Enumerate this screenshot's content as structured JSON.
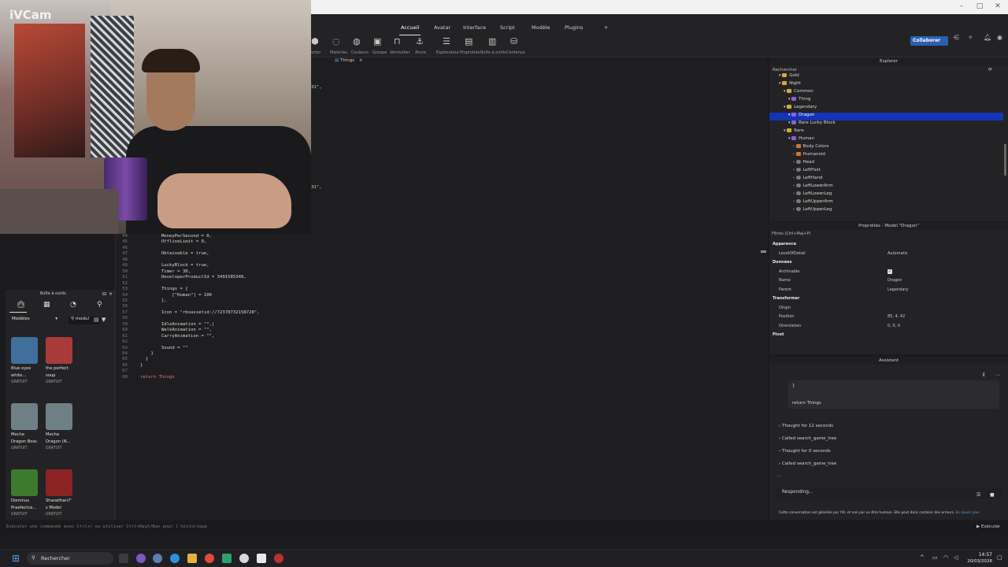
{
  "window": {
    "minimize": "–",
    "maximize": "□",
    "close": "✕"
  },
  "ribbon": {
    "tabs": [
      "Accueil",
      "Avatar",
      "Interface",
      "Script",
      "Modèle",
      "Plugins",
      "+"
    ],
    "collaborate": "Collaborer",
    "tools": [
      "porter",
      "Matériau",
      "Couleurs",
      "Groupe",
      "Verrouiller",
      "Ancre",
      "Explorateur",
      "Propriétés",
      "Boîte à outils",
      "Contenus"
    ]
  },
  "editor": {
    "doc_tab": "Things",
    "top_fragments": [
      "31\",",
      "31\","
    ],
    "lines": [
      {
        "n": "44",
        "text": "        MoneyPerSecond = 0,"
      },
      {
        "n": "45",
        "text": "        OfflineLimit = 0,"
      },
      {
        "n": "46",
        "text": ""
      },
      {
        "n": "47",
        "text": "        Obtainable = true,"
      },
      {
        "n": "48",
        "text": ""
      },
      {
        "n": "49",
        "text": "        LuckyBlock = true,"
      },
      {
        "n": "50",
        "text": "        Timer = 30,"
      },
      {
        "n": "51",
        "text": "        DeveloperProductId = 3491585348,"
      },
      {
        "n": "52",
        "text": ""
      },
      {
        "n": "53",
        "text": "        Things = {"
      },
      {
        "n": "54",
        "text": "            [\"Human\"] = 100"
      },
      {
        "n": "55",
        "text": "        },"
      },
      {
        "n": "56",
        "text": ""
      },
      {
        "n": "57",
        "text": "        Icon = \"rbxassetid://72378732158728\","
      },
      {
        "n": "58",
        "text": ""
      },
      {
        "n": "59",
        "text": "        IdleAnimation = \"\",|"
      },
      {
        "n": "60",
        "text": "        WalkAnimation = \"\","
      },
      {
        "n": "61",
        "text": "        CarryAnimation = \"\","
      },
      {
        "n": "62",
        "text": ""
      },
      {
        "n": "63",
        "text": "        Sound = \"\""
      },
      {
        "n": "64",
        "text": "    }"
      },
      {
        "n": "65",
        "text": "  }"
      },
      {
        "n": "66",
        "text": "}"
      },
      {
        "n": "67",
        "text": ""
      },
      {
        "n": "68",
        "text": "return Things"
      }
    ]
  },
  "toolbox": {
    "title": "Boîte à outils",
    "category": "Modèles",
    "search_value": "modul",
    "assets": [
      {
        "name1": "Blue eyes",
        "name2": "white...",
        "price": "GRATUIT",
        "color": "#3f6f9a"
      },
      {
        "name1": "the perfect",
        "name2": "soup",
        "price": "GRATUIT",
        "color": "#a83a3a"
      },
      {
        "name1": "Mecha",
        "name2": "Dragon Boss",
        "price": "GRATUIT",
        "color": "#6f7f86"
      },
      {
        "name1": "Mecha",
        "name2": "Dragon (N...",
        "price": "GRATUIT",
        "color": "#6f7f86"
      },
      {
        "name1": "Dominus",
        "name2": "Praefectus...",
        "price": "GRATUIT",
        "color": "#3c7a2e"
      },
      {
        "name1": "Shanethan7'",
        "name2": "s Model",
        "price": "GRATUIT",
        "color": "#8b2323"
      }
    ]
  },
  "explorer": {
    "title": "Explorer",
    "search": "Rechercher",
    "items": [
      {
        "label": "Gold",
        "type": "folder",
        "indent": 1
      },
      {
        "label": "Night",
        "type": "folder",
        "indent": 1
      },
      {
        "label": "Common",
        "type": "folder",
        "indent": 2
      },
      {
        "label": "Thing",
        "type": "model",
        "indent": 3
      },
      {
        "label": "Legendary",
        "type": "folder",
        "indent": 2
      },
      {
        "label": "Dragon",
        "type": "model",
        "indent": 3,
        "selected": true
      },
      {
        "label": "Rare Lucky Block",
        "type": "model",
        "indent": 3
      },
      {
        "label": "Rare",
        "type": "folder",
        "indent": 2
      },
      {
        "label": "Human",
        "type": "model",
        "indent": 3
      },
      {
        "label": "Body Colors",
        "type": "gear",
        "indent": 4
      },
      {
        "label": "Humanoid",
        "type": "gear",
        "indent": 4
      },
      {
        "label": "Head",
        "type": "part",
        "indent": 4
      },
      {
        "label": "LeftFoot",
        "type": "part",
        "indent": 4
      },
      {
        "label": "LeftHand",
        "type": "part",
        "indent": 4
      },
      {
        "label": "LeftLowerArm",
        "type": "part",
        "indent": 4
      },
      {
        "label": "LeftLowerLeg",
        "type": "part",
        "indent": 4
      },
      {
        "label": "LeftUpperArm",
        "type": "part",
        "indent": 4
      },
      {
        "label": "LeftUpperLeg",
        "type": "part",
        "indent": 4
      }
    ]
  },
  "properties": {
    "title": "Propriétés - Model \"Dragon\"",
    "filter": "Filtres (Ctrl+Maj+P)",
    "rows": [
      {
        "label": "Apparence",
        "cat": true
      },
      {
        "label": "LevelOfDetail",
        "value": "Automatic"
      },
      {
        "label": "Données",
        "cat": true
      },
      {
        "label": "Archivable",
        "check": true
      },
      {
        "label": "Name",
        "value": "Dragon"
      },
      {
        "label": "Parent",
        "value": "Legendary"
      },
      {
        "label": "Transformer",
        "cat": true
      },
      {
        "label": "Origin",
        "value": ""
      },
      {
        "label": "Position",
        "value": "85, 4, 42"
      },
      {
        "label": "Orientation",
        "value": "0, 0, 0"
      },
      {
        "label": "Pivot",
        "cat": true
      }
    ]
  },
  "assistant": {
    "title": "Assistant",
    "code_close": "}",
    "code_return": "return Things",
    "steps": [
      "Thought for 12 seconds",
      "Called search_game_tree",
      "Thought for 0 seconds",
      "Called search_game_tree"
    ],
    "ellipsis": "...",
    "input_placeholder": "Responding...",
    "disclaimer": "Cette conversation est générée par l'IA, et non par un être humain. Elle peut donc contenir des erreurs.",
    "learn_more": "En savoir plus"
  },
  "command_bar": {
    "placeholder": "Exécuter une commande avec Ctrl+/ ou utiliser Ctrl+Haut/Bas pour l'historique",
    "run": "Exécuter"
  },
  "webcam": {
    "label": "iVCam"
  },
  "taskbar": {
    "search": "Rechercher",
    "time": "14:57",
    "date": "20/03/2026"
  }
}
